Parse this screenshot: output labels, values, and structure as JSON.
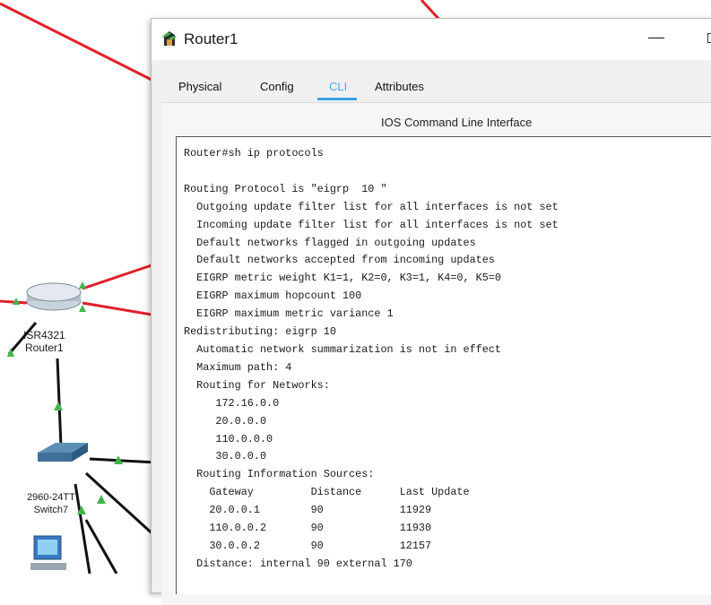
{
  "topology": {
    "devices": [
      {
        "name": "router",
        "label": "ISR4321\nRouter1"
      },
      {
        "name": "switch",
        "label": "2960-24TT\nSwitch7"
      },
      {
        "name": "pc",
        "label": ""
      }
    ],
    "colors": {
      "link_down": "#e0202a",
      "link_up": "#111111",
      "port_up": "#3fb54a"
    }
  },
  "window": {
    "title": "Router1",
    "icon": "router-app-icon",
    "minimize_glyph": "—"
  },
  "tabs": [
    {
      "label": "Physical",
      "active": false
    },
    {
      "label": "Config",
      "active": false
    },
    {
      "label": "CLI",
      "active": true
    },
    {
      "label": "Attributes",
      "active": false
    }
  ],
  "cli": {
    "heading": "IOS Command Line Interface",
    "console_output": "Router#sh ip protocols\n\nRouting Protocol is \"eigrp  10 \"\n  Outgoing update filter list for all interfaces is not set\n  Incoming update filter list for all interfaces is not set\n  Default networks flagged in outgoing updates\n  Default networks accepted from incoming updates\n  EIGRP metric weight K1=1, K2=0, K3=1, K4=0, K5=0\n  EIGRP maximum hopcount 100\n  EIGRP maximum metric variance 1\nRedistributing: eigrp 10\n  Automatic network summarization is not in effect\n  Maximum path: 4\n  Routing for Networks:\n     172.16.0.0\n     20.0.0.0\n     110.0.0.0\n     30.0.0.0\n  Routing Information Sources:\n    Gateway         Distance      Last Update\n    20.0.0.1        90            11929\n    110.0.0.2       90            11930\n    30.0.0.2        90            12157\n  Distance: internal 90 external 170"
  }
}
